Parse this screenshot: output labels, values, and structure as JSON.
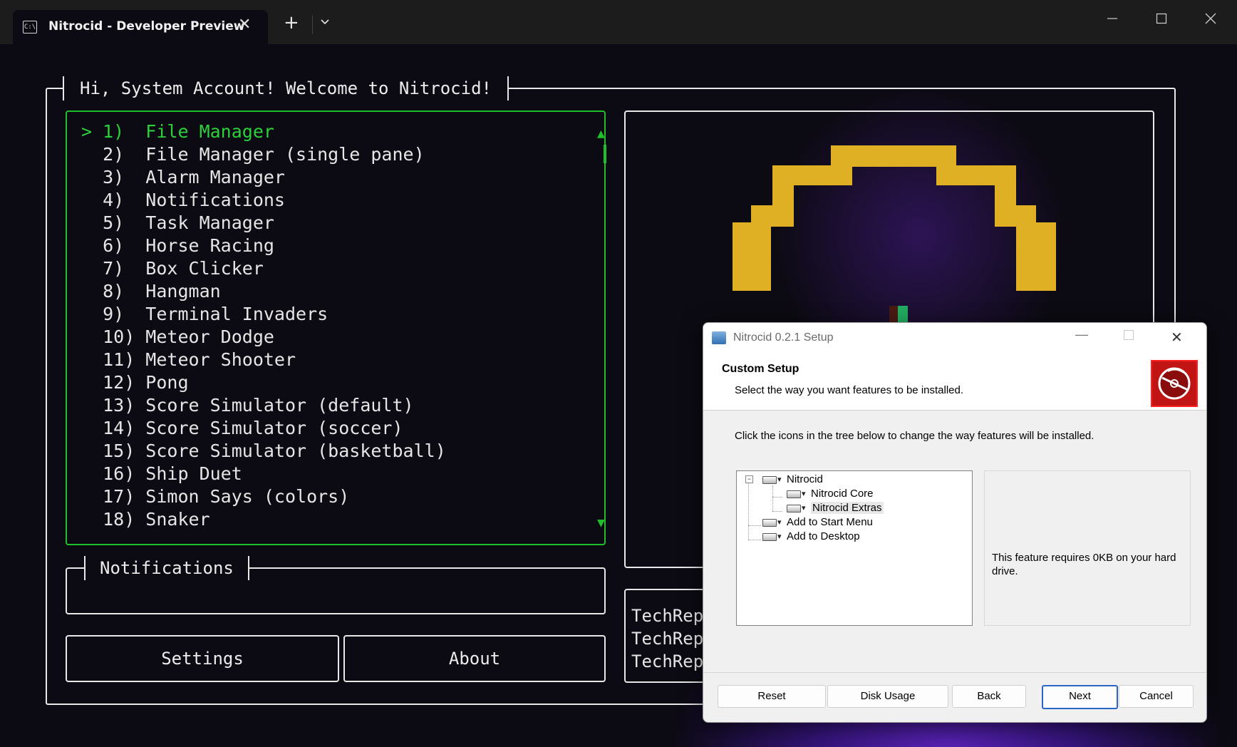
{
  "titlebar": {
    "tab_title": "Nitrocid - Developer Preview",
    "tab_icon": "terminal-icon",
    "close_tab_glyph": "✕",
    "new_tab_glyph": "+",
    "dropdown_glyph": "⌄",
    "minimize_glyph": "—",
    "maximize_glyph": "☐",
    "close_glyph": "✕"
  },
  "terminal": {
    "welcome": "Hi, System Account! Welcome to Nitrocid!",
    "menu_items": [
      "> 1)  File Manager",
      "  2)  File Manager (single pane)",
      "  3)  Alarm Manager",
      "  4)  Notifications",
      "  5)  Task Manager",
      "  6)  Horse Racing",
      "  7)  Box Clicker",
      "  8)  Hangman",
      "  9)  Terminal Invaders",
      "  10) Meteor Dodge",
      "  11) Meteor Shooter",
      "  12) Pong",
      "  13) Score Simulator (default)",
      "  14) Score Simulator (soccer)",
      "  15) Score Simulator (basketball)",
      "  16) Ship Duet",
      "  17) Simon Says (colors)",
      "  18) Snaker"
    ],
    "selected_index": 0,
    "scroll_up": "▲",
    "scroll_down": "▼",
    "notifications_title": "Notifications",
    "settings_button": "Settings",
    "about_button": "About",
    "rss_lines": [
      "TechRepu",
      "TechRepu",
      "TechRepu"
    ],
    "colors": {
      "accent": "#1fbf2b",
      "selected_text": "#2cd13a",
      "art_gold": "#e0b024"
    }
  },
  "setup_dialog": {
    "title": "Nitrocid 0.2.1 Setup",
    "heading": "Custom Setup",
    "subheading": "Select the way you want features to be installed.",
    "instruction": "Click the icons in the tree below to change the way features will be installed.",
    "tree": [
      {
        "label": "Nitrocid",
        "level": 0,
        "expanded": true
      },
      {
        "label": "Nitrocid Core",
        "level": 1
      },
      {
        "label": "Nitrocid Extras",
        "level": 1,
        "highlighted": true
      },
      {
        "label": "Add to Start Menu",
        "level": 0
      },
      {
        "label": "Add to Desktop",
        "level": 0
      }
    ],
    "expander_glyph": "−",
    "feature_description": "This feature requires 0KB on your hard drive.",
    "buttons": {
      "reset": "Reset",
      "disk_usage": "Disk Usage",
      "back": "Back",
      "next": "Next",
      "cancel": "Cancel"
    },
    "minimize_glyph": "—",
    "close_glyph": "✕"
  }
}
